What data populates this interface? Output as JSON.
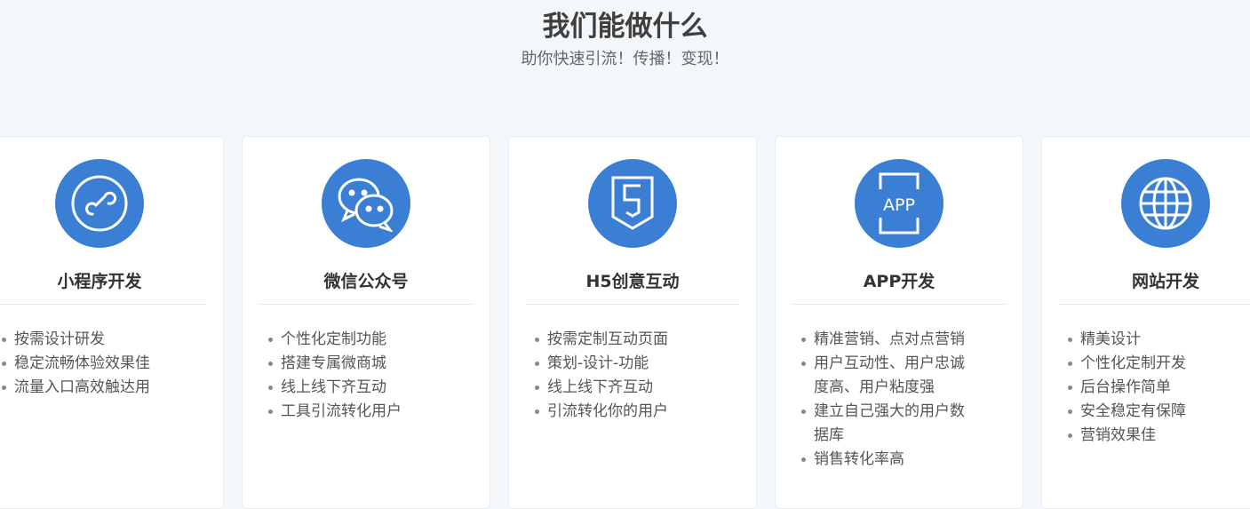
{
  "header": {
    "title": "我们能做什么",
    "subtitle": "助你快速引流！传播！变现！"
  },
  "cards": [
    {
      "title": "小程序开发",
      "icon": "mini-program-icon",
      "items": [
        "按需设计研发",
        "稳定流畅体验效果佳",
        "流量入口高效触达用"
      ]
    },
    {
      "title": "微信公众号",
      "icon": "wechat-icon",
      "items": [
        "个性化定制功能",
        "搭建专属微商城",
        "线上线下齐互动",
        "工具引流转化用户"
      ]
    },
    {
      "title": "H5创意互动",
      "icon": "html5-icon",
      "items": [
        "按需定制互动页面",
        "策划-设计-功能",
        "线上线下齐互动",
        "引流转化你的用户"
      ]
    },
    {
      "title": "APP开发",
      "icon": "app-icon",
      "items": [
        "精准营销、点对点营销",
        "用户互动性、用户忠诚度高、用户粘度强",
        "建立自己强大的用户数据库",
        "销售转化率高"
      ]
    },
    {
      "title": "网站开发",
      "icon": "globe-icon",
      "items": [
        "精美设计",
        "个性化定制开发",
        "后台操作简单",
        "安全稳定有保障",
        "营销效果佳"
      ]
    }
  ],
  "colors": {
    "accent": "#3b7fd4",
    "background": "#f4f7fa"
  }
}
